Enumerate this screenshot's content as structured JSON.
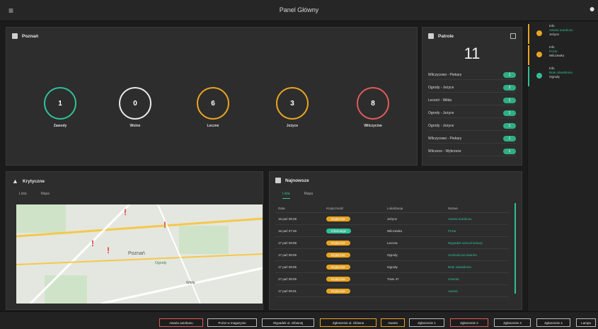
{
  "header": {
    "menu_icon": "hamburger-icon",
    "title": "Panel Główny",
    "user_icon": "user-icon"
  },
  "overview": {
    "title": "Poznań",
    "icon": "calendar-icon",
    "stats": [
      {
        "value": "1",
        "label": "Zawody",
        "color": "#2fbf98"
      },
      {
        "value": "0",
        "label": "Wolne",
        "color": "#e8e8e8"
      },
      {
        "value": "6",
        "label": "Leczne",
        "color": "#e8a423"
      },
      {
        "value": "3",
        "label": "Jeżyce",
        "color": "#e8a423"
      },
      {
        "value": "8",
        "label": "Wilczyców",
        "color": "#e05a5a"
      }
    ]
  },
  "patrols": {
    "title": "Patrole",
    "icon": "bar-icon",
    "count": "11",
    "rows": [
      {
        "label": "Wilczycowo - Piekary",
        "value": "1"
      },
      {
        "label": "Ogrody - Jeżyce",
        "value": "2"
      },
      {
        "label": "Leczeń - Wilda",
        "value": "1"
      },
      {
        "label": "Ogrody - Jeżyce",
        "value": "1"
      },
      {
        "label": "Ogrody - Jeżyce",
        "value": "1"
      },
      {
        "label": "Wilczycowo - Piekary",
        "value": "1"
      },
      {
        "label": "Wilczece - Wybrzeże",
        "value": "1"
      }
    ]
  },
  "critical": {
    "title": "Krytyczne",
    "tabs": [
      "Lista",
      "Mapa"
    ],
    "active_tab": 1,
    "map_labels": [
      "Poznań",
      "Ogrody",
      "Wilda"
    ]
  },
  "latest": {
    "title": "Najnowsze",
    "tabs": [
      "Lista",
      "Mapa"
    ],
    "columns": [
      "Data",
      "Krytyczność",
      "Lokalizacja",
      "Nazwa"
    ],
    "rows": [
      {
        "date": "16 paź 09:28",
        "status": "Krytyczne",
        "status_color": "#e8a423",
        "location": "Jeżyce",
        "name": "Awaria autobusu"
      },
      {
        "date": "16 paź 07:46",
        "status": "Informacje",
        "status_color": "#2fbf98",
        "location": "Wilczewko",
        "name": "Pożar"
      },
      {
        "date": "17 paź 09:08",
        "status": "Krytyczne",
        "status_color": "#e8a423",
        "location": "Leczna",
        "name": "Wypadek samochodowy"
      },
      {
        "date": "17 paź 09:05",
        "status": "Krytyczne",
        "status_color": "#e8a423",
        "location": "Ogrody",
        "name": "Uszkodzona latarnia"
      },
      {
        "date": "17 paź 09:05",
        "status": "Krytyczne",
        "status_color": "#e8a423",
        "location": "Ogrody",
        "name": "Brak oświetlenia"
      },
      {
        "date": "17 paź 09:05",
        "status": "Krytyczne",
        "status_color": "#e8a423",
        "location": "Tram 47",
        "name": "Usterka"
      },
      {
        "date": "17 paź 09:01",
        "status": "Krytyczne",
        "status_color": "#e8a423",
        "location": "",
        "name": "Awaria"
      }
    ]
  },
  "sidebar": [
    {
      "line1": "Info",
      "line2": "Awaria autobusu",
      "line3": "Jeżyce",
      "accent": "#e8a423"
    },
    {
      "line1": "Info",
      "line2": "Pożar",
      "line3": "Wilczewko",
      "accent": "#e8a423"
    },
    {
      "line1": "Info",
      "line2": "Brak oświetlenia",
      "line3": "Ogrody",
      "accent": "#2fbf98"
    }
  ],
  "bottom_buttons": [
    {
      "label": "Awaria autobusu",
      "color": "#e05a5a"
    },
    {
      "label": "Pożar w magazynie",
      "color": "#bbbbbb"
    },
    {
      "label": "Wypadek ul. Głównej",
      "color": "#bbbbbb"
    },
    {
      "label": "Zgłoszenie ul. Główna",
      "color": "#e8a423"
    },
    {
      "label": "Awaria",
      "color": "#e8a423"
    },
    {
      "label": "Zgłoszenie 1",
      "color": "#bbbbbb"
    },
    {
      "label": "Zgłoszenie 2",
      "color": "#e05a5a"
    },
    {
      "label": "Zgłoszenie 3",
      "color": "#bbbbbb"
    },
    {
      "label": "Zgłoszenie 4",
      "color": "#bbbbbb"
    },
    {
      "label": "Lampa",
      "color": "#bbbbbb"
    }
  ]
}
